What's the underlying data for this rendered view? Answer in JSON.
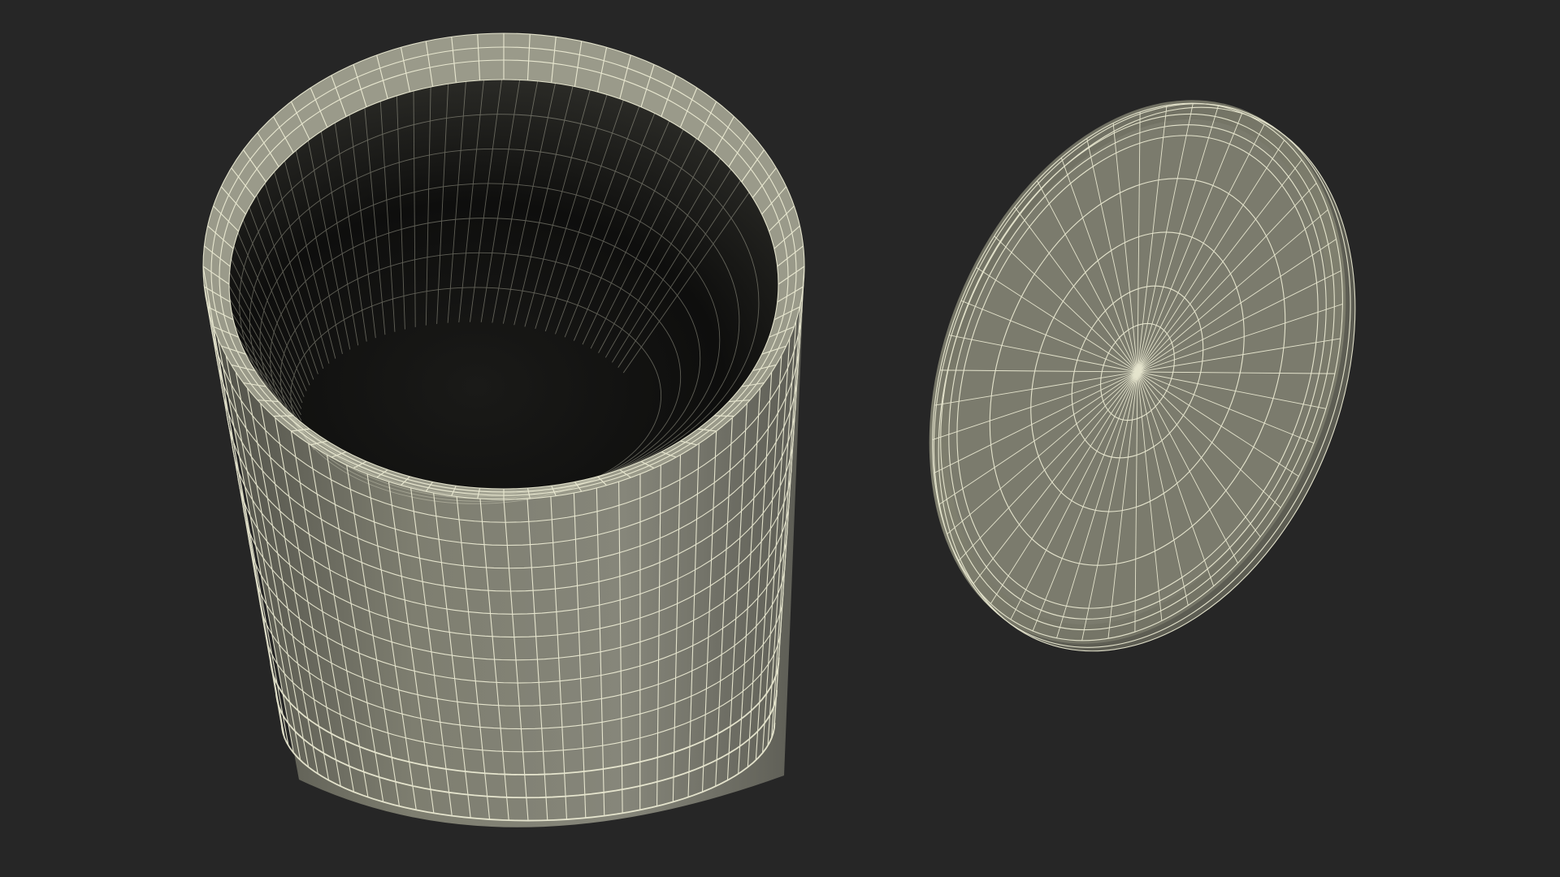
{
  "scene": {
    "background_color": "#262626",
    "wire_color": "#f1f0d8",
    "outer_surface_color": "#7f7f71",
    "inner_shadow_color": "#0d0d0c",
    "lid_surface_color": "#7c7c6e",
    "objects": [
      {
        "name": "open-canister",
        "kind": "wireframe cylinder viewed from above, open top"
      },
      {
        "name": "canister-lid",
        "kind": "wireframe disc lid, tilted"
      }
    ]
  }
}
